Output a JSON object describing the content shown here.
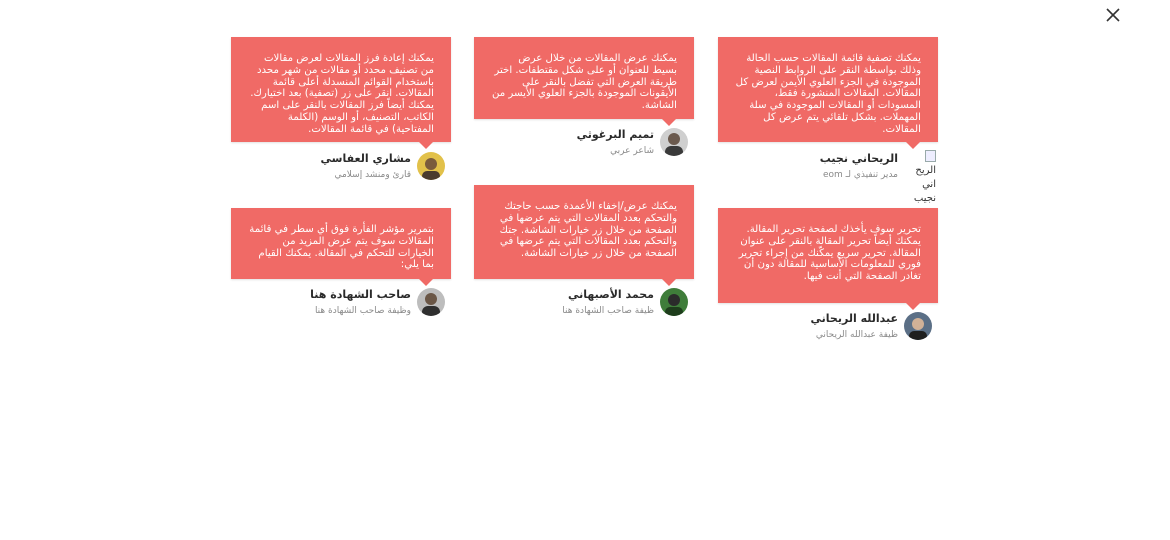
{
  "close_label": "×",
  "testimonials": [
    {
      "text": "يمكنك تصفية قائمة المقالات حسب الحالة وذلك بواسطة النقر على الروابط النصية الموجودة في الجزء العلوي الأيمن لعرض كل المقالات. المقالات المنشورة فقط، المسودات أو المقالات الموجودة في سلة المهملات. بشكل تلقائي يتم عرض كل المقالات.",
      "name": "الريحاني نجيب",
      "role": "مدير تنفيذي لـ eom",
      "avatar_alt_line1": "الريح",
      "avatar_alt_line2": "اني",
      "avatar_alt_line3": "نجيب"
    },
    {
      "text": "يمكنك عرض المقالات من خلال عرض بسيط للعنوان أو على شكل مقتطفات. اختر طريقة العرض التي تفضل بالنقر على الأيقونات الموجودة بالجزء العلوي الأيسر من الشاشة.",
      "name": "تميم البرغوثي",
      "role": "شاعر عربي"
    },
    {
      "text": "يمكنك إعادة فرز المقالات لعرض مقالات من تصنيف محدد أو مقالات من شهر محدد باستخدام القوائم المنسدلة أعلى قائمة المقالات. انقر على زر (تصفية) بعد اختيارك. يمكنك أيضاً فرز المقالات بالنقر على اسم الكاتب، التصنيف، أو الوسم (الكلمة المفتاحية) في قائمة المقالات.",
      "name": "مشاري العفاسي",
      "role": "قارئ ومنشد إسلامي"
    },
    {
      "text": "تحرير سوف يأخذك لصفحة تحرير المقالة. يمكنك أيضاً تحرير المقالة بالنقر على عنوان المقالة. تحرير سريع يمكّنك من إجراء تحرير فوري للمعلومات الأساسية للمقالة دون أن تغادر الصفحة التي أنت فيها.",
      "name": "عبدالله الريحاني",
      "role": "ظيفة عبدالله الريحاني"
    },
    {
      "text": "يمكنك عرض/إخفاء الأعمدة حسب حاجتك والتحكم بعدد المقالات التي يتم عرضها في الصفحة من خلال زر خيارات الشاشة. جتك والتحكم بعدد المقالات التي يتم عرضها في الصفحة من خلال زر خيارات الشاشة.",
      "name": "محمد الأصبهاني",
      "role": "ظيفة صاحب الشهادة هنا"
    },
    {
      "text": "بتمرير مؤشر الفأرة فوق أي سطر في قائمة المقالات سوف يتم عرض المزيد من الخيارات للتحكم في المقالة. يمكنك القيام بما يلي:",
      "name": "صاحب الشهادة هنا",
      "role": "وظيفة صاحب الشهادة هنا"
    }
  ]
}
